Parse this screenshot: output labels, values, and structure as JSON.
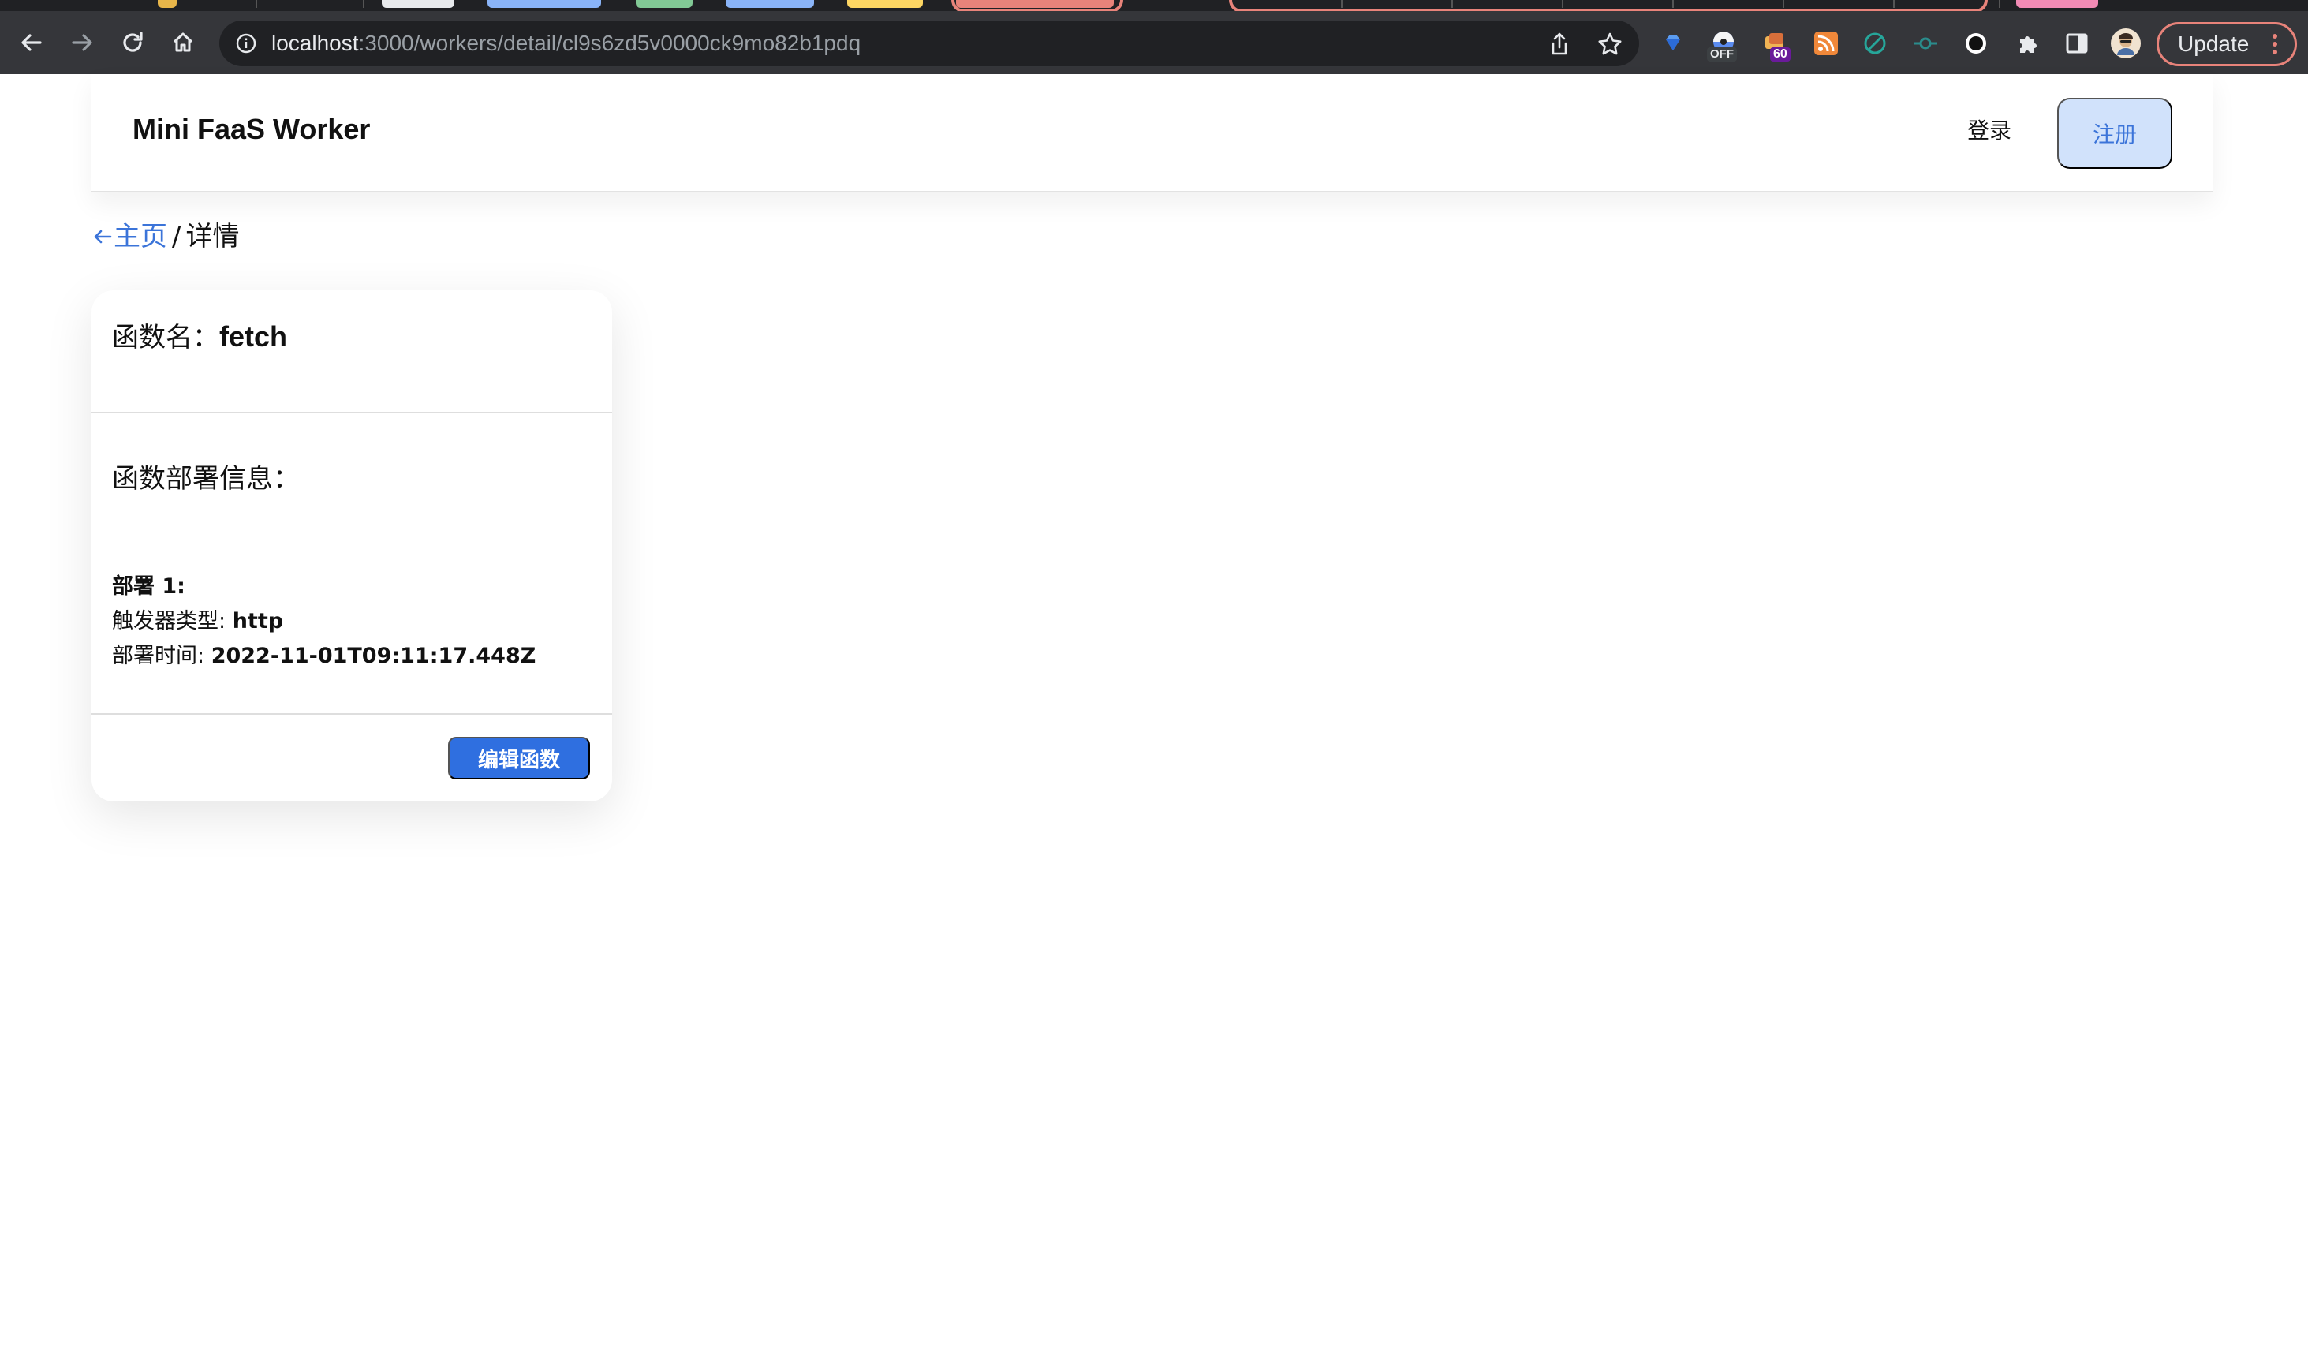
{
  "browser": {
    "url_host": "localhost",
    "url_path": ":3000/workers/detail/cl9s6zd5v0000ck9mo82b1pdq",
    "update_label": "Update",
    "ext_badges": {
      "off": "OFF",
      "count": "60"
    },
    "colors": {
      "chrome_bg": "#202124",
      "toolbar_bg": "#35363a",
      "update_border": "#e8837a"
    }
  },
  "header": {
    "brand": "Mini FaaS Worker",
    "login_label": "登录",
    "register_label": "注册"
  },
  "breadcrumb": {
    "home_label": "主页",
    "separator": "/",
    "current": "详情"
  },
  "card": {
    "name_label": "函数名：",
    "name_value": "fetch",
    "deploy_section_title": "函数部署信息：",
    "deployment": {
      "title": "部署 1:",
      "trigger_label": "触发器类型: ",
      "trigger_value": "http",
      "time_label": "部署时间: ",
      "time_value": "2022-11-01T09:11:17.448Z"
    },
    "edit_label": "编辑函数"
  },
  "colors": {
    "accent": "#2f6fe0",
    "link": "#3b74d9",
    "register_bg": "#d1e2fb"
  }
}
